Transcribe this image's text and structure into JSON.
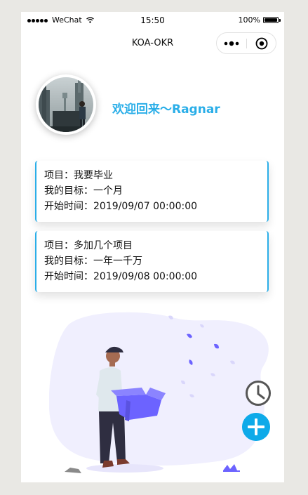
{
  "status_bar": {
    "carrier": "WeChat",
    "time": "15:50",
    "battery": "100%"
  },
  "nav": {
    "title": "KOA-OKR",
    "capsule_icons": [
      "more-icon",
      "close-icon"
    ]
  },
  "profile": {
    "welcome": "欢迎回来～Ragnar"
  },
  "cards": [
    {
      "project": "项目：我要毕业",
      "goal": "我的目标：一个月",
      "start": "开始时间：2019/09/07 00:00:00"
    },
    {
      "project": "项目：多加几个项目",
      "goal": "我的目标：一年一千万",
      "start": "开始时间：2019/09/08 00:00:00"
    }
  ],
  "actions": {
    "history_icon": "clock-icon",
    "add_icon": "plus-icon"
  },
  "colors": {
    "accent": "#2aaee8",
    "fab": "#0eaae9",
    "illustration_purple": "#6c63ff",
    "blob": "#f0effe"
  }
}
